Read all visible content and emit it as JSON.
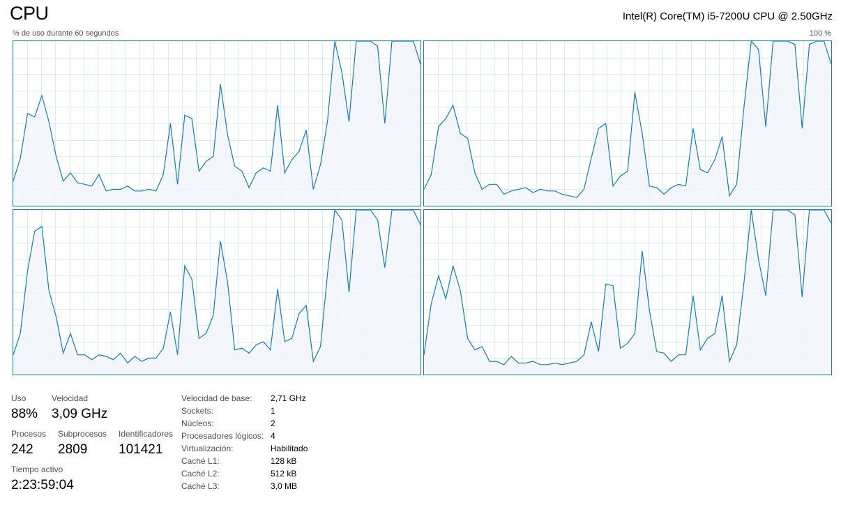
{
  "header": {
    "title": "CPU",
    "cpu_model": "Intel(R) Core(TM) i5-7200U CPU @ 2.50GHz",
    "graph_caption": "% de uso durante 60 segundos",
    "graph_max": "100 %"
  },
  "colors": {
    "line": "#117dbb",
    "fill": "#f1f6fa",
    "grid": "#d9eaf4",
    "border": "#117dbb"
  },
  "chart_data": {
    "type": "area",
    "x_points": 60,
    "ylim": [
      0,
      100
    ],
    "series": [
      {
        "values": [
          15,
          29,
          56,
          54,
          67,
          51,
          30,
          15,
          20,
          14,
          13,
          12,
          19,
          9,
          10,
          10,
          12,
          9,
          9,
          10,
          9,
          19,
          50,
          13,
          55,
          53,
          21,
          27,
          30,
          74,
          43,
          24,
          21,
          11,
          20,
          23,
          21,
          61,
          20,
          28,
          33,
          46,
          10,
          25,
          52,
          100,
          81,
          51,
          100,
          100,
          100,
          97,
          50,
          100,
          100,
          100,
          100,
          86
        ]
      },
      {
        "values": [
          10,
          19,
          48,
          53,
          61,
          44,
          41,
          20,
          10,
          13,
          13,
          7,
          9,
          10,
          11,
          8,
          10,
          9,
          9,
          7,
          6,
          5,
          10,
          29,
          47,
          50,
          12,
          18,
          21,
          69,
          44,
          12,
          11,
          7,
          11,
          13,
          12,
          47,
          22,
          20,
          28,
          42,
          6,
          13,
          60,
          100,
          95,
          48,
          100,
          100,
          100,
          98,
          47,
          98,
          100,
          100,
          86
        ]
      },
      {
        "values": [
          12,
          25,
          63,
          87,
          90,
          51,
          35,
          13,
          25,
          12,
          12,
          9,
          12,
          11,
          9,
          13,
          7,
          11,
          8,
          10,
          10,
          16,
          38,
          12,
          66,
          58,
          22,
          25,
          36,
          81,
          56,
          15,
          16,
          13,
          18,
          20,
          15,
          52,
          20,
          22,
          37,
          42,
          8,
          17,
          62,
          100,
          94,
          50,
          100,
          100,
          100,
          94,
          65,
          100,
          100,
          100,
          100,
          91
        ]
      },
      {
        "values": [
          12,
          43,
          60,
          46,
          66,
          51,
          22,
          15,
          17,
          8,
          8,
          6,
          11,
          7,
          7,
          8,
          6,
          6,
          7,
          6,
          7,
          8,
          12,
          32,
          14,
          55,
          54,
          16,
          19,
          25,
          75,
          39,
          14,
          13,
          8,
          12,
          12,
          48,
          15,
          22,
          25,
          48,
          8,
          18,
          56,
          100,
          70,
          48,
          100,
          100,
          100,
          97,
          47,
          100,
          100,
          100,
          92
        ]
      }
    ]
  },
  "stats": {
    "uso_label": "Uso",
    "uso_value": "88%",
    "velocidad_label": "Velocidad",
    "velocidad_value": "3,09 GHz",
    "procesos_label": "Procesos",
    "procesos_value": "242",
    "subprocesos_label": "Subprocesos",
    "subprocesos_value": "2809",
    "identificadores_label": "Identificadores",
    "identificadores_value": "101421",
    "tiempo_label": "Tiempo activo",
    "tiempo_value": "2:23:59:04"
  },
  "specs": [
    {
      "label": "Velocidad de base:",
      "value": "2,71 GHz"
    },
    {
      "label": "Sockets:",
      "value": "1"
    },
    {
      "label": "Núcleos:",
      "value": "2"
    },
    {
      "label": "Procesadores lógicos:",
      "value": "4"
    },
    {
      "label": "Virtualización:",
      "value": "Habilitado"
    },
    {
      "label": "Caché L1:",
      "value": "128 kB"
    },
    {
      "label": "Caché L2:",
      "value": "512 kB"
    },
    {
      "label": "Caché L3:",
      "value": "3,0 MB"
    }
  ]
}
